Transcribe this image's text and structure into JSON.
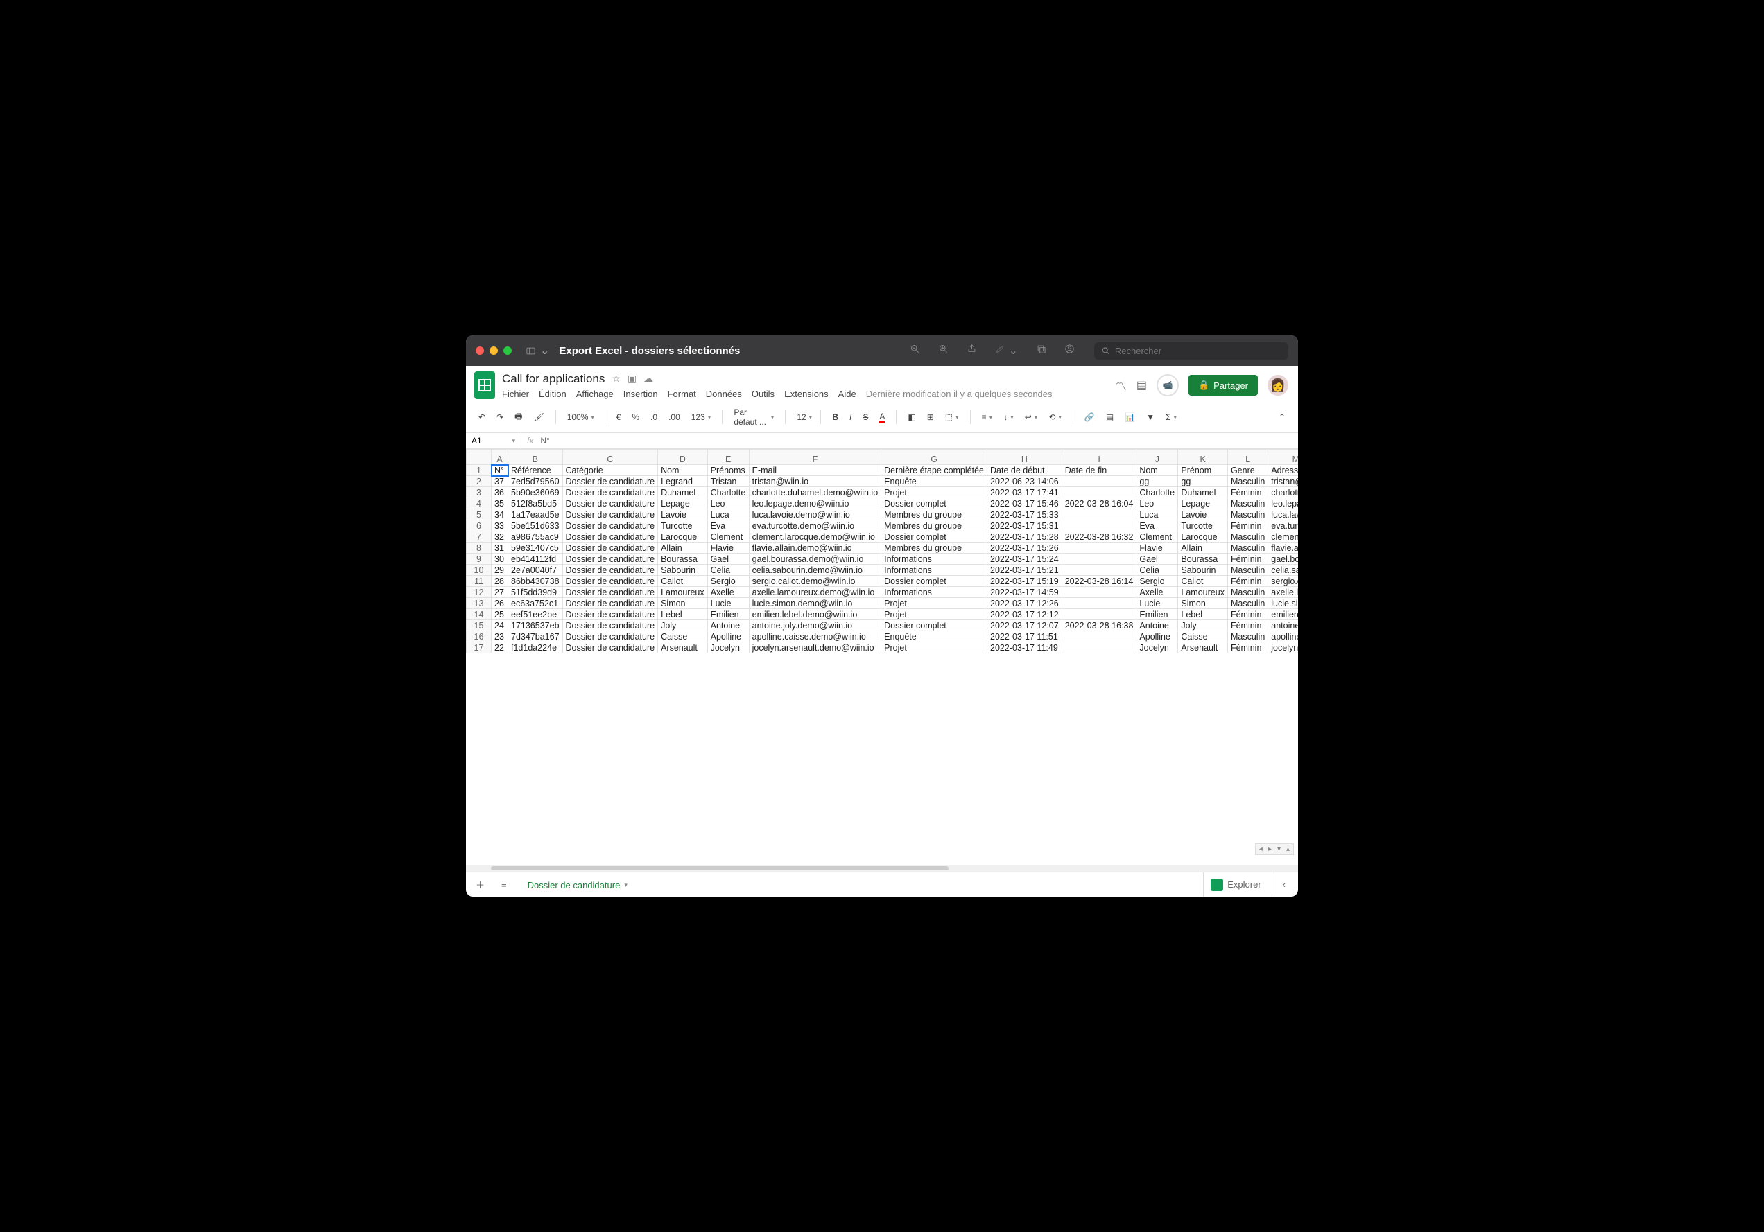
{
  "window_title": "Export Excel - dossiers sélectionnés",
  "search_placeholder": "Rechercher",
  "doc_title": "Call for applications",
  "menubar": [
    "Fichier",
    "Édition",
    "Affichage",
    "Insertion",
    "Format",
    "Données",
    "Outils",
    "Extensions",
    "Aide"
  ],
  "last_modified": "Dernière modification il y a quelques secondes",
  "share_label": "Partager",
  "toolbar": {
    "zoom": "100%",
    "currency": "€",
    "percent": "%",
    "dec_dec": ".0",
    "dec_inc": ".00",
    "more_formats": "123",
    "font_family": "Par défaut ...",
    "font_size": "12"
  },
  "namebox": "A1",
  "formula": "N°",
  "columns_letters": [
    "A",
    "B",
    "C",
    "D",
    "E",
    "F",
    "G",
    "H",
    "I",
    "J",
    "K",
    "L",
    "M"
  ],
  "headers": [
    "N°",
    "Référence",
    "Catégorie",
    "Nom",
    "Prénoms",
    "E-mail",
    "Dernière étape complétée",
    "Date de début",
    "Date de fin",
    "Nom",
    "Prénom",
    "Genre",
    "Adresse e-"
  ],
  "rows": [
    {
      "n": "37",
      "ref": "7ed5d79560",
      "cat": "Dossier de candidature",
      "nom": "Legrand",
      "pre": "Tristan",
      "mail": "tristan@wiin.io",
      "etape": "Enquête",
      "deb": "2022-06-23  14:06",
      "fin": "",
      "nom2": "gg",
      "pre2": "gg",
      "genre": "Masculin",
      "adr": "tristan@w",
      "tall": "row-tall",
      "rn": "2"
    },
    {
      "n": "36",
      "ref": "5b90e36069",
      "cat": "Dossier de candidature",
      "nom": "Duhamel",
      "pre": "Charlotte",
      "mail": "charlotte.duhamel.demo@wiin.io",
      "etape": "Projet",
      "deb": "2022-03-17  17:41",
      "fin": "",
      "nom2": "Charlotte",
      "pre2": "Duhamel",
      "genre": "Féminin",
      "adr": "charlotte.c",
      "tall": "row-med",
      "rn": "3"
    },
    {
      "n": "35",
      "ref": "512f8a5bd5",
      "cat": "Dossier de candidature",
      "nom": "Lepage",
      "pre": "Leo",
      "mail": "leo.lepage.demo@wiin.io",
      "etape": "Dossier complet",
      "deb": "2022-03-17  15:46",
      "fin": "2022-03-28  16:04",
      "nom2": "Leo",
      "pre2": "Lepage",
      "genre": "Masculin",
      "adr": "leo.lepage",
      "tall": "row-med",
      "rn": "4"
    },
    {
      "n": "34",
      "ref": "1a17eaad5e",
      "cat": "Dossier de candidature",
      "nom": "Lavoie",
      "pre": "Luca",
      "mail": "luca.lavoie.demo@wiin.io",
      "etape": "Membres du groupe",
      "deb": "2022-03-17  15:33",
      "fin": "",
      "nom2": "Luca",
      "pre2": "Lavoie",
      "genre": "Masculin",
      "adr": "luca.lavoie",
      "tall": "",
      "rn": "5"
    },
    {
      "n": "33",
      "ref": "5be151d633",
      "cat": "Dossier de candidature",
      "nom": "Turcotte",
      "pre": "Eva",
      "mail": "eva.turcotte.demo@wiin.io",
      "etape": "Membres du groupe",
      "deb": "2022-03-17  15:31",
      "fin": "",
      "nom2": "Eva",
      "pre2": "Turcotte",
      "genre": "Féminin",
      "adr": "eva.turcot",
      "tall": "",
      "rn": "6"
    },
    {
      "n": "32",
      "ref": "a986755ac9",
      "cat": "Dossier de candidature",
      "nom": "Larocque",
      "pre": "Clement",
      "mail": "clement.larocque.demo@wiin.io",
      "etape": "Dossier complet",
      "deb": "2022-03-17  15:28",
      "fin": "2022-03-28  16:32",
      "nom2": "Clement",
      "pre2": "Larocque",
      "genre": "Masculin",
      "adr": "clement.la",
      "tall": "",
      "rn": "7"
    },
    {
      "n": "31",
      "ref": "59e31407c5",
      "cat": "Dossier de candidature",
      "nom": "Allain",
      "pre": "Flavie",
      "mail": "flavie.allain.demo@wiin.io",
      "etape": "Membres du groupe",
      "deb": "2022-03-17  15:26",
      "fin": "",
      "nom2": "Flavie",
      "pre2": "Allain",
      "genre": "Masculin",
      "adr": "flavie.allai",
      "tall": "",
      "rn": "8"
    },
    {
      "n": "30",
      "ref": "eb414112fd",
      "cat": "Dossier de candidature",
      "nom": "Bourassa",
      "pre": "Gael",
      "mail": "gael.bourassa.demo@wiin.io",
      "etape": "Informations",
      "deb": "2022-03-17  15:24",
      "fin": "",
      "nom2": "Gael",
      "pre2": "Bourassa",
      "genre": "Féminin",
      "adr": "gael.boura",
      "tall": "",
      "rn": "9"
    },
    {
      "n": "29",
      "ref": "2e7a0040f7",
      "cat": "Dossier de candidature",
      "nom": "Sabourin",
      "pre": "Celia",
      "mail": "celia.sabourin.demo@wiin.io",
      "etape": "Informations",
      "deb": "2022-03-17  15:21",
      "fin": "",
      "nom2": "Celia",
      "pre2": "Sabourin",
      "genre": "Masculin",
      "adr": "celia.sabo",
      "tall": "",
      "rn": "10"
    },
    {
      "n": "28",
      "ref": "86bb430738",
      "cat": "Dossier de candidature",
      "nom": "Cailot",
      "pre": "Sergio",
      "mail": "sergio.cailot.demo@wiin.io",
      "etape": "Dossier complet",
      "deb": "2022-03-17  15:19",
      "fin": "2022-03-28  16:14",
      "nom2": "Sergio",
      "pre2": "Cailot",
      "genre": "Féminin",
      "adr": "sergio.cail",
      "tall": "",
      "rn": "11"
    },
    {
      "n": "27",
      "ref": "51f5dd39d9",
      "cat": "Dossier de candidature",
      "nom": "Lamoureux",
      "pre": "Axelle",
      "mail": "axelle.lamoureux.demo@wiin.io",
      "etape": "Informations",
      "deb": "2022-03-17  14:59",
      "fin": "",
      "nom2": "Axelle",
      "pre2": "Lamoureux",
      "genre": "Masculin",
      "adr": "axelle.lam",
      "tall": "",
      "rn": "12"
    },
    {
      "n": "26",
      "ref": "ec63a752c1",
      "cat": "Dossier de candidature",
      "nom": "Simon",
      "pre": "Lucie",
      "mail": "lucie.simon.demo@wiin.io",
      "etape": "Projet",
      "deb": "2022-03-17  12:26",
      "fin": "",
      "nom2": "Lucie",
      "pre2": "Simon",
      "genre": "Masculin",
      "adr": "lucie.simo",
      "tall": "row-med",
      "rn": "13"
    },
    {
      "n": "25",
      "ref": "eef51ee2be",
      "cat": "Dossier de candidature",
      "nom": "Lebel",
      "pre": "Emilien",
      "mail": "emilien.lebel.demo@wiin.io",
      "etape": "Projet",
      "deb": "2022-03-17  12:12",
      "fin": "",
      "nom2": "Emilien",
      "pre2": "Lebel",
      "genre": "Féminin",
      "adr": "emilien.lel",
      "tall": "row-med",
      "rn": "14"
    },
    {
      "n": "24",
      "ref": "17136537eb",
      "cat": "Dossier de candidature",
      "nom": "Joly",
      "pre": "Antoine",
      "mail": "antoine.joly.demo@wiin.io",
      "etape": "Dossier complet",
      "deb": "2022-03-17  12:07",
      "fin": "2022-03-28  16:38",
      "nom2": "Antoine",
      "pre2": "Joly",
      "genre": "Féminin",
      "adr": "antoine.jo",
      "tall": "row-med",
      "rn": "15"
    },
    {
      "n": "23",
      "ref": "7d347ba167",
      "cat": "Dossier de candidature",
      "nom": "Caisse",
      "pre": "Apolline",
      "mail": "apolline.caisse.demo@wiin.io",
      "etape": "Enquête",
      "deb": "2022-03-17  11:51",
      "fin": "",
      "nom2": "Apolline",
      "pre2": "Caisse",
      "genre": "Masculin",
      "adr": "apolline.ca",
      "tall": "row-med",
      "rn": "16"
    },
    {
      "n": "22",
      "ref": "f1d1da224e",
      "cat": "Dossier de candidature",
      "nom": "Arsenault",
      "pre": "Jocelyn",
      "mail": "jocelyn.arsenault.demo@wiin.io",
      "etape": "Projet",
      "deb": "2022-03-17  11:49",
      "fin": "",
      "nom2": "Jocelyn",
      "pre2": "Arsenault",
      "genre": "Féminin",
      "adr": "jocelyn.ars",
      "tall": "row-med",
      "rn": "17"
    }
  ],
  "sheet_tab": "Dossier de candidature",
  "explore_label": "Explorer"
}
